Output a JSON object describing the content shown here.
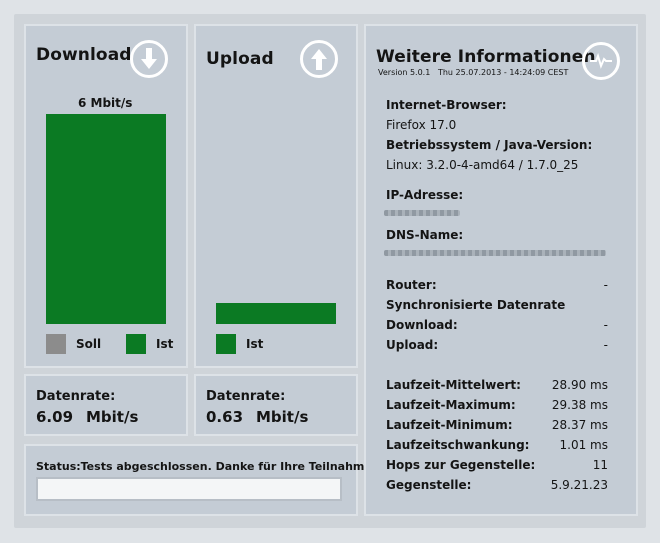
{
  "download": {
    "title": "Download",
    "icon": "arrow-down-circle-icon",
    "bar_label": "6 Mbit/s",
    "legend_soll": "Soll",
    "legend_ist": "Ist",
    "legend_soll_color": "#8c8c8c",
    "legend_ist_color": "#0b7a23",
    "rate_label": "Datenrate:",
    "rate_value": "6.09",
    "rate_unit": "Mbit/s",
    "bar_fraction": 1.0
  },
  "upload": {
    "title": "Upload",
    "icon": "arrow-up-circle-icon",
    "legend_ist": "Ist",
    "rate_label": "Datenrate:",
    "rate_value": "0.63",
    "rate_unit": "Mbit/s",
    "bar_fraction": 0.1
  },
  "status": {
    "label": "Status:",
    "text": "Tests abgeschlossen. Danke für Ihre Teilnahme!",
    "progress_fraction": 1.0
  },
  "info": {
    "title": "Weitere Informationen",
    "icon": "heartbeat-circle-icon",
    "version": "Version 5.0.1",
    "timestamp": "Thu 25.07.2013 - 14:24:09 CEST",
    "browser_label": "Internet-Browser:",
    "browser_value": "Firefox 17.0",
    "os_label": "Betriebssystem / Java-Version:",
    "os_value": "Linux: 3.2.0-4-amd64 / 1.7.0_25",
    "ip_label": "IP-Adresse:",
    "dns_label": "DNS-Name:",
    "router_label": "Router:",
    "router_value": "-",
    "sync_label": "Synchronisierte Datenrate",
    "sync_download_label": "Download:",
    "sync_download_value": "-",
    "sync_upload_label": "Upload:",
    "sync_upload_value": "-",
    "latency_mean_label": "Laufzeit-Mittelwert:",
    "latency_mean_value": "28.90 ms",
    "latency_max_label": "Laufzeit-Maximum:",
    "latency_max_value": "29.38 ms",
    "latency_min_label": "Laufzeit-Minimum:",
    "latency_min_value": "28.37 ms",
    "jitter_label": "Laufzeitschwankung:",
    "jitter_value": "1.01 ms",
    "hops_label": "Hops zur Gegenstelle:",
    "hops_value": "11",
    "peer_label": "Gegenstelle:",
    "peer_value": "5.9.21.23"
  }
}
